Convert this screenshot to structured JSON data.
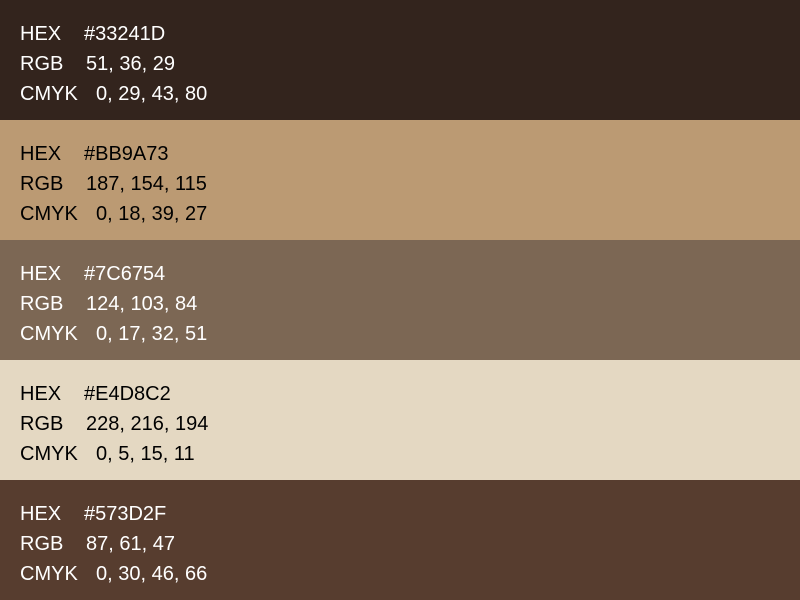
{
  "labels": {
    "hex": "HEX",
    "rgb": "RGB",
    "cmyk": "CMYK"
  },
  "swatches": [
    {
      "color": "#33241D",
      "text_color": "#FFFFFF",
      "hex": "#33241D",
      "rgb": "51, 36, 29",
      "cmyk": "0, 29, 43, 80"
    },
    {
      "color": "#BB9A73",
      "text_color": "#000000",
      "hex": "#BB9A73",
      "rgb": "187, 154, 115",
      "cmyk": "0, 18, 39, 27"
    },
    {
      "color": "#7C6754",
      "text_color": "#FFFFFF",
      "hex": "#7C6754",
      "rgb": "124, 103, 84",
      "cmyk": "0, 17, 32, 51"
    },
    {
      "color": "#E4D8C2",
      "text_color": "#000000",
      "hex": "#E4D8C2",
      "rgb": "228, 216, 194",
      "cmyk": "0, 5, 15, 11"
    },
    {
      "color": "#573D2F",
      "text_color": "#FFFFFF",
      "hex": "#573D2F",
      "rgb": "87, 61, 47",
      "cmyk": "0, 30, 46, 66"
    }
  ]
}
